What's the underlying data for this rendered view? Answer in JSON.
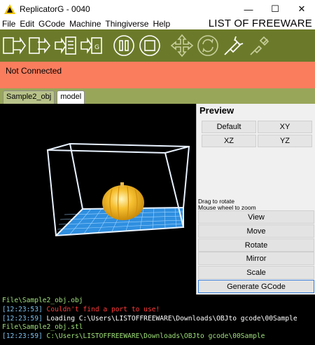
{
  "window": {
    "title": "ReplicatorG - 0040",
    "min": "—",
    "max": "☐",
    "close": "✕"
  },
  "watermark": "LIST OF FREEWARE",
  "menu": [
    "File",
    "Edit",
    "GCode",
    "Machine",
    "Thingiverse",
    "Help"
  ],
  "toolbar": {
    "buttons": [
      {
        "icon": "build-icon"
      },
      {
        "icon": "build-to-file-icon"
      },
      {
        "icon": "upload-icon"
      },
      {
        "icon": "gcode-generate-icon"
      },
      {
        "icon": "pause-icon"
      },
      {
        "icon": "stop-icon"
      },
      {
        "icon": "jog-control-icon"
      },
      {
        "icon": "reset-icon"
      },
      {
        "icon": "connect-icon"
      },
      {
        "icon": "disconnect-icon"
      }
    ]
  },
  "status": "Not Connected",
  "tabs": [
    {
      "label": "Sample2_obj",
      "active": false
    },
    {
      "label": "model",
      "active": true
    }
  ],
  "preview": {
    "title": "Preview",
    "views": [
      "Default",
      "XY",
      "XZ",
      "YZ"
    ],
    "hint_rotate": "Drag to rotate",
    "hint_zoom": "Mouse wheel to zoom",
    "actions": [
      "View",
      "Move",
      "Rotate",
      "Mirror",
      "Scale",
      "Generate GCode"
    ]
  },
  "console": [
    {
      "ts": "",
      "text": "File\\Sample2_obj.obj",
      "color": "green"
    },
    {
      "ts": "[12:23:53]",
      "text": " Couldn't find a port to use!",
      "color": "red"
    },
    {
      "ts": "[12:23:59]",
      "text": " Loading C:\\Users\\LISTOFFREEWARE\\Downloads\\OBJto gcode\\00Sample",
      "color": "white"
    },
    {
      "ts": "",
      "text": "File\\Sample2_obj.stl",
      "color": "green"
    },
    {
      "ts": "[12:23:59]",
      "text": " C:\\Users\\LISTOFFREEWARE\\Downloads\\OBJto gcode\\00Sample",
      "color": "green"
    }
  ],
  "colors": {
    "toolbar": "#6b7a2a",
    "status": "#fa7d5e",
    "tabbar": "#98a65a"
  }
}
